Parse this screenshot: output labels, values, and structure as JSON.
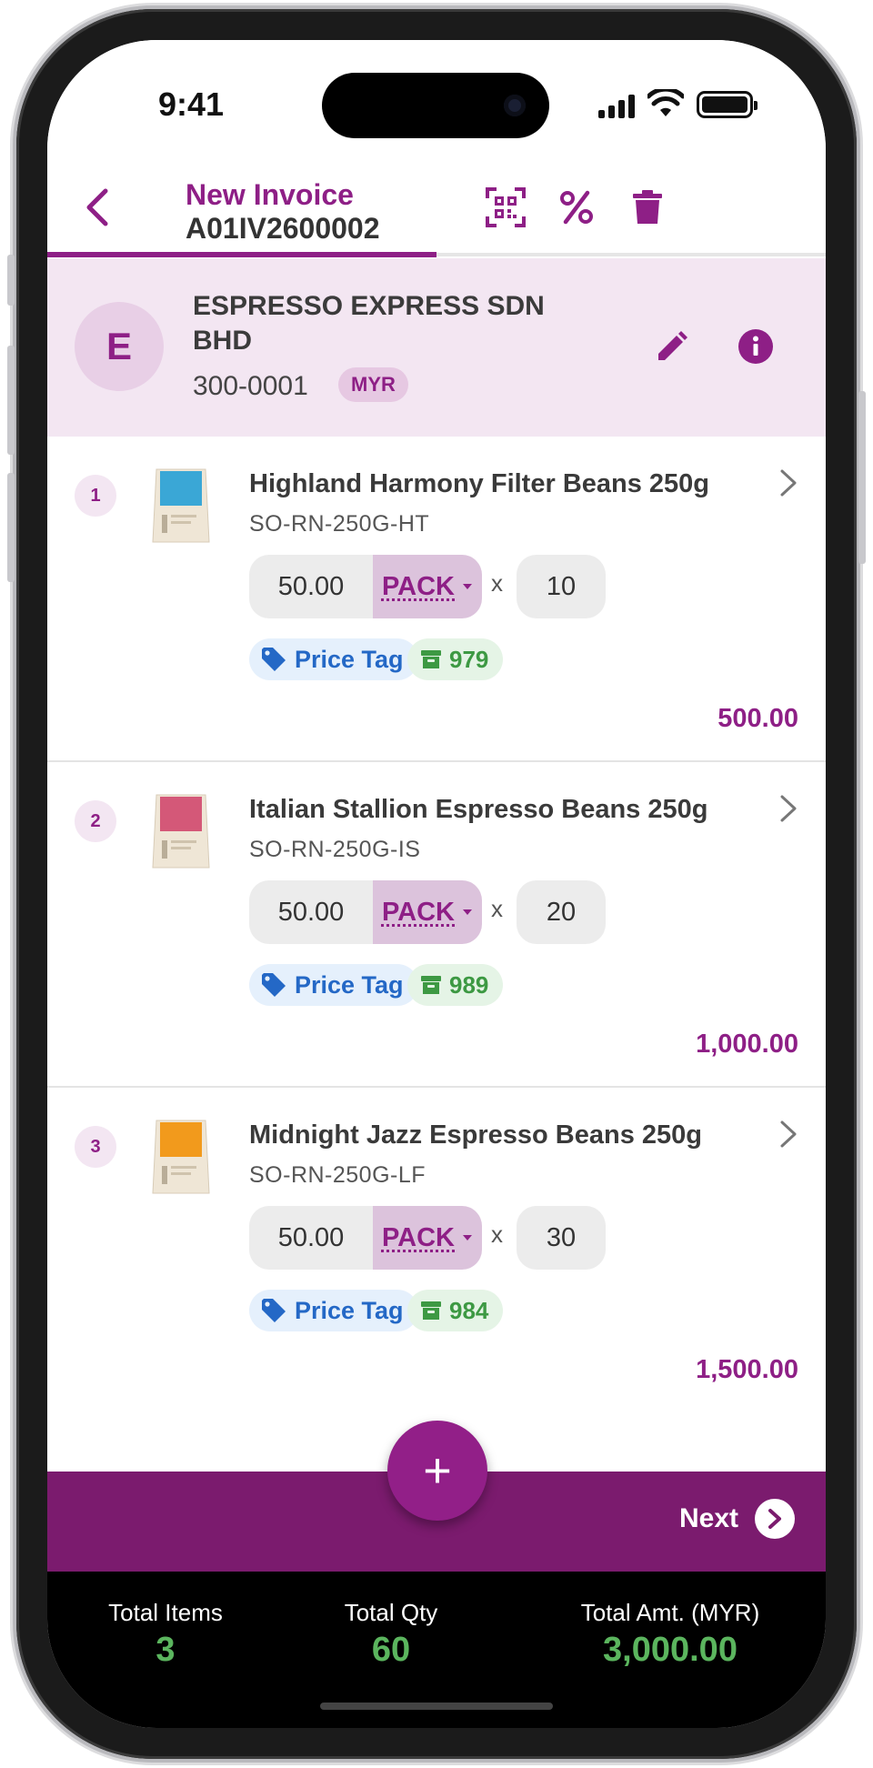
{
  "status_bar": {
    "time": "9:41"
  },
  "header": {
    "title": "New Invoice",
    "doc_number": "A01IV2600002",
    "progress": 0.5,
    "icons": [
      "back-chevron-icon",
      "qr-scan-icon",
      "percent-icon",
      "trash-icon"
    ]
  },
  "customer": {
    "initial": "E",
    "name": "ESPRESSO EXPRESS SDN BHD",
    "code": "300-0001",
    "currency": "MYR"
  },
  "items": [
    {
      "index": "1",
      "name": "Highland Harmony Filter Beans 250g",
      "sku": "SO-RN-250G-HT",
      "price": "50.00",
      "uom": "PACK",
      "times": "x",
      "qty": "10",
      "price_tag": "Price Tag",
      "stock": "979",
      "total": "500.00",
      "thumb_color": "#3aa7d6"
    },
    {
      "index": "2",
      "name": "Italian Stallion Espresso Beans 250g",
      "sku": "SO-RN-250G-IS",
      "price": "50.00",
      "uom": "PACK",
      "times": "x",
      "qty": "20",
      "price_tag": "Price Tag",
      "stock": "989",
      "total": "1,000.00",
      "thumb_color": "#d45878"
    },
    {
      "index": "3",
      "name": "Midnight Jazz Espresso Beans 250g",
      "sku": "SO-RN-250G-LF",
      "price": "50.00",
      "uom": "PACK",
      "times": "x",
      "qty": "30",
      "price_tag": "Price Tag",
      "stock": "984",
      "total": "1,500.00",
      "thumb_color": "#f29a1c"
    }
  ],
  "footer": {
    "add_label": "+",
    "next_label": "Next",
    "total_items_label": "Total Items",
    "total_items": "3",
    "total_qty_label": "Total Qty",
    "total_qty": "60",
    "total_amt_label": "Total Amt. (MYR)",
    "total_amt": "3,000.00"
  },
  "colors": {
    "brand": "#8e1f86",
    "bar": "#7b1b6e",
    "customer_bg": "#f3e6f2",
    "tag_blue": "#2468c6",
    "stock_green": "#3d9943",
    "total_green": "#5bb55e"
  }
}
